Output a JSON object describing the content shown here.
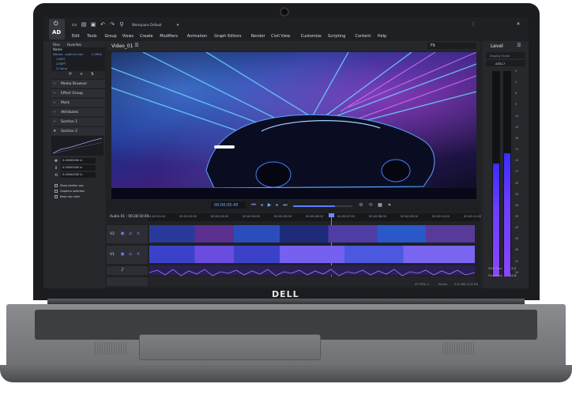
{
  "app": {
    "logo_top": "⏻",
    "logo_text": "AD",
    "workspace": "Workspace Default",
    "menu": [
      "Edit",
      "Tools",
      "Group",
      "Views",
      "Create",
      "Modifiers",
      "Animation",
      "Graph Editors",
      "Render",
      "Civil View",
      "Customize",
      "Scripting",
      "Content",
      "Help"
    ]
  },
  "left_panel": {
    "tabs": [
      "Files",
      "Favorites"
    ],
    "files_header": "Name",
    "files": [
      "Motion...audio.fr.mov",
      "1.MP4",
      "2.RAPT",
      "3.Comp"
    ],
    "file_size": "2.2KHz",
    "sections": [
      "Media Browser",
      "Effect Group",
      "Mark",
      "Attributes",
      "Section 1",
      "Section 2"
    ],
    "fields": [
      "0.00000000 in",
      "0.00000000 in",
      "0.00000000 in"
    ],
    "checkboxes": [
      "Show section cap",
      "Graphics selection",
      "Keep cap color"
    ]
  },
  "viewer": {
    "title": "Video_01",
    "fit": "Fit",
    "timecode": "00:00:05:45"
  },
  "timeline": {
    "label": "Audio 01 : 00:28:10:45",
    "ticks": [
      "00:00:01:00",
      "00:00:02:00",
      "00:00:03:00",
      "00:00:04:00",
      "00:00:05:00",
      "00:00:06:00",
      "00:00:07:00",
      "00:00:08:00",
      "00:00:09:00",
      "00:00:10:00",
      "00:00:11:00"
    ],
    "tracks": [
      "V2",
      "V1"
    ],
    "status": [
      "AT STRS: 4",
      "Stereo",
      "0.00 MB: 0.00 MB",
      "0.1 KB"
    ]
  },
  "level_panel": {
    "title": "Level",
    "options": [
      "Display Scale",
      "AES17"
    ],
    "scale": [
      "0",
      "3",
      "6",
      "9",
      "12",
      "15",
      "18",
      "21",
      "24",
      "27",
      "30",
      "33",
      "36",
      "39",
      "42",
      "45",
      "48",
      "51",
      "54"
    ],
    "meter_levels": [
      0.55,
      0.6
    ],
    "rms_label": "RMS Max",
    "rms_value": "2.2",
    "peak_label": "Peak Max",
    "peak_value": "11.8"
  },
  "brand": {
    "logo": "DELL"
  },
  "colors": {
    "accent": "#5b7cff",
    "meter": "#7a3cff",
    "ui_bg": "#202226",
    "chassis": "#7b7d81"
  }
}
